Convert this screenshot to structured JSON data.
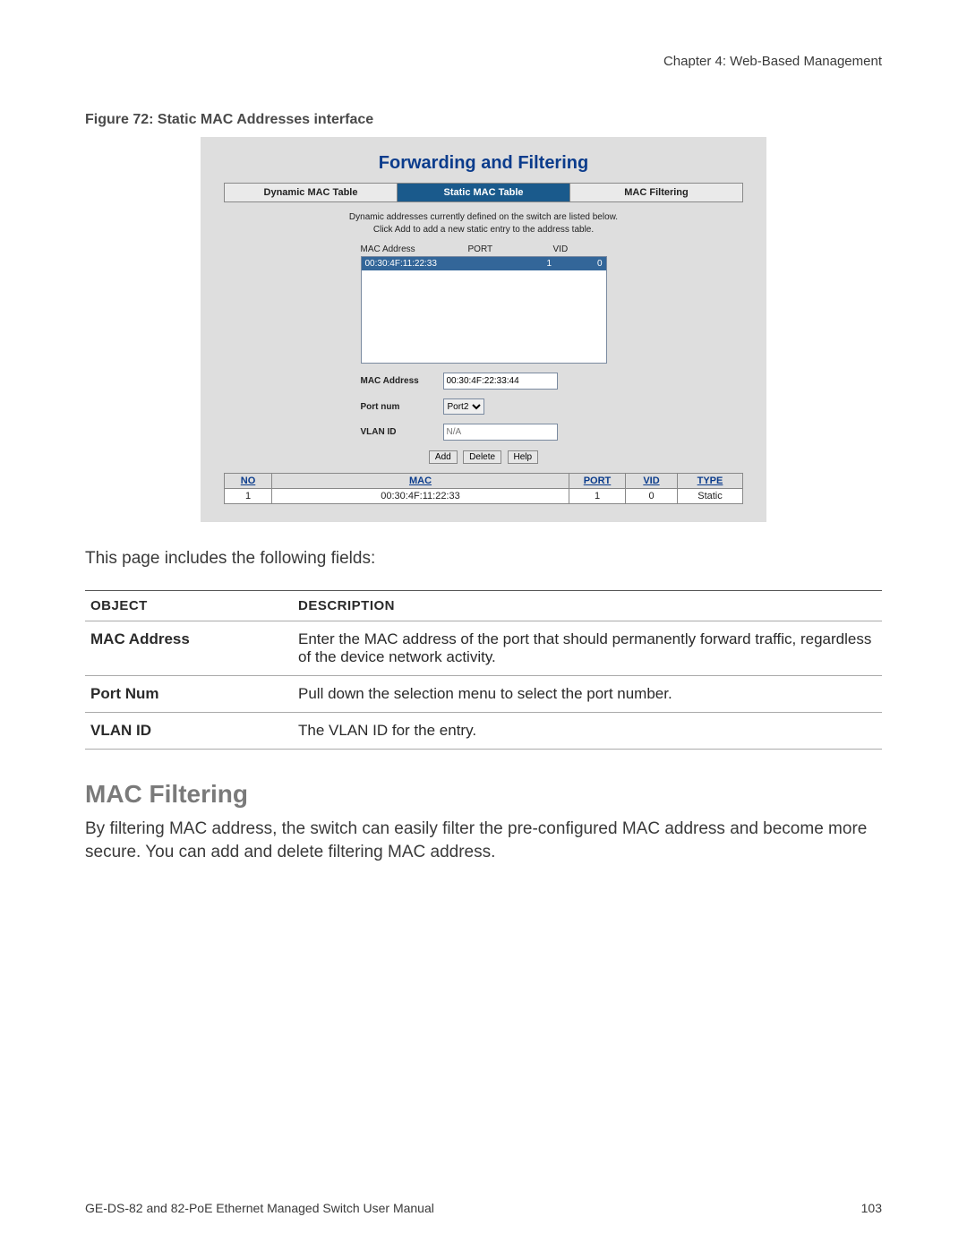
{
  "header": {
    "chapter": "Chapter 4: Web-Based Management"
  },
  "figure": {
    "caption": "Figure 72: Static MAC Addresses interface"
  },
  "screenshot": {
    "title": "Forwarding and Filtering",
    "tabs": [
      {
        "label": "Dynamic MAC Table",
        "active": false
      },
      {
        "label": "Static MAC Table",
        "active": true
      },
      {
        "label": "MAC Filtering",
        "active": false
      }
    ],
    "info_line1": "Dynamic addresses currently defined on the switch are listed below.",
    "info_line2": "Click Add to add a new static entry to the address table.",
    "col_labels": {
      "mac": "MAC Address",
      "port": "PORT",
      "vid": "VID"
    },
    "listbox_row": {
      "mac": "00:30:4F:11:22:33",
      "port": "1",
      "vid": "0"
    },
    "form": {
      "mac_label": "MAC Address",
      "mac_value": "00:30:4F:22:33:44",
      "port_label": "Port num",
      "port_value": "Port2",
      "vlan_label": "VLAN ID",
      "vlan_placeholder": "N/A"
    },
    "buttons": {
      "add": "Add",
      "delete": "Delete",
      "help": "Help"
    },
    "result_headers": {
      "no": "NO",
      "mac": "MAC",
      "port": "PORT",
      "vid": "VID",
      "type": "TYPE"
    },
    "result_row": {
      "no": "1",
      "mac": "00:30:4F:11:22:33",
      "port": "1",
      "vid": "0",
      "type": "Static"
    }
  },
  "intro_text": "This page includes the following fields:",
  "desc_table": {
    "headers": {
      "object": "OBJECT",
      "description": "DESCRIPTION"
    },
    "rows": [
      {
        "object": "MAC Address",
        "description": "Enter the MAC address of the port that should permanently forward traffic, regardless of the device network activity."
      },
      {
        "object": "Port Num",
        "description": "Pull down the selection menu to select the port number."
      },
      {
        "object": "VLAN ID",
        "description": "The VLAN ID for the entry."
      }
    ]
  },
  "section": {
    "heading": "MAC Filtering",
    "body": "By filtering MAC address, the switch can easily filter the pre-configured MAC address and become more secure. You can add and delete filtering MAC address."
  },
  "footer": {
    "left": "GE-DS-82 and 82-PoE Ethernet Managed Switch User Manual",
    "right": "103"
  }
}
